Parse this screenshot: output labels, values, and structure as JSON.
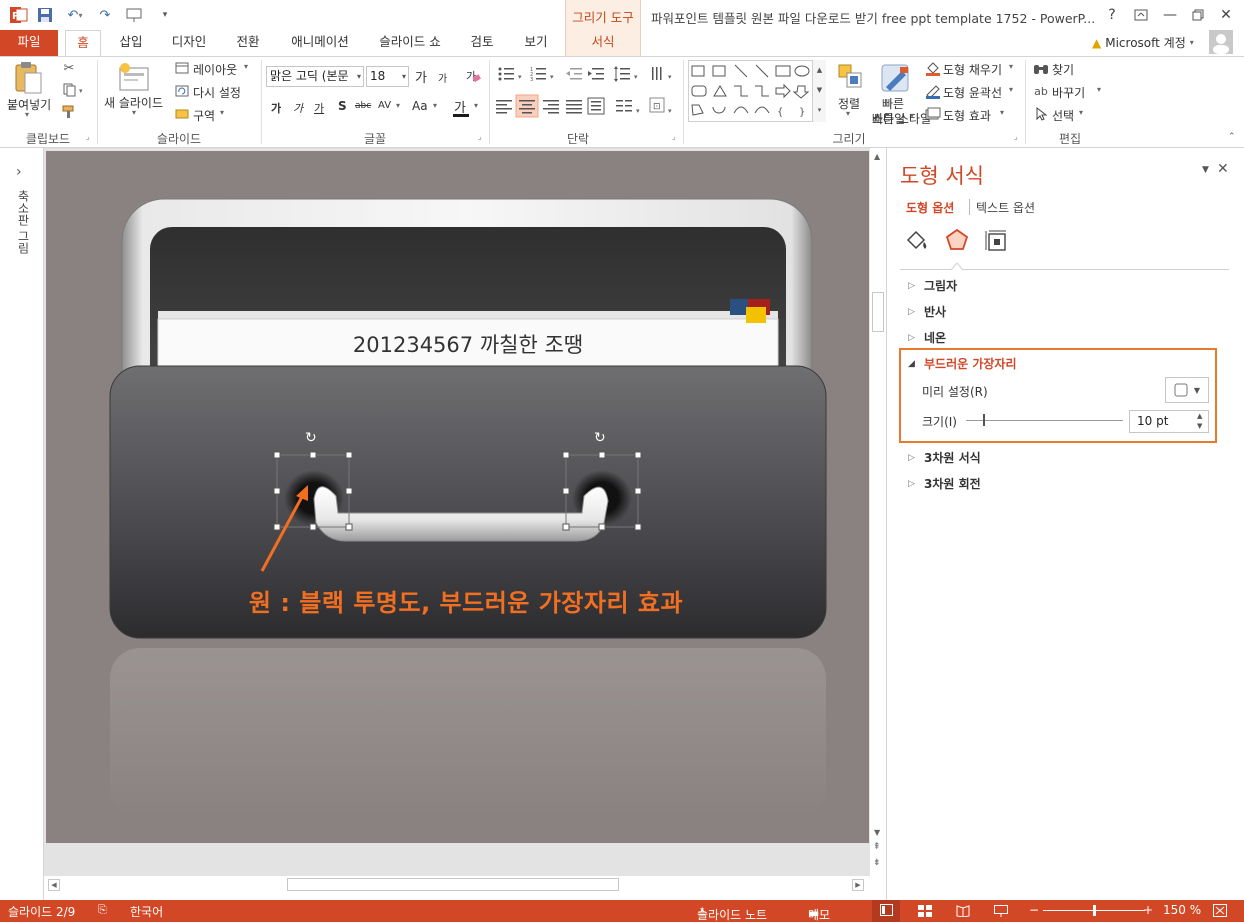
{
  "window": {
    "title": "파워포인트 템플릿 원본 파일 다운로드 받기 free ppt template 1752 - PowerP...",
    "help": "?",
    "context_group": "그리기 도구",
    "account": "Microsoft 계정"
  },
  "tabs": [
    {
      "label": "파일"
    },
    {
      "label": "홈"
    },
    {
      "label": "삽입"
    },
    {
      "label": "디자인"
    },
    {
      "label": "전환"
    },
    {
      "label": "애니메이션"
    },
    {
      "label": "슬라이드 쇼"
    },
    {
      "label": "검토"
    },
    {
      "label": "보기"
    },
    {
      "label": "서식"
    }
  ],
  "ribbon": {
    "clipboard": {
      "name": "클립보드",
      "paste": "붙여넣기"
    },
    "slides": {
      "name": "슬라이드",
      "new_slide": "새 슬라이드",
      "layout": "레이아웃",
      "reset": "다시 설정",
      "section": "구역"
    },
    "font": {
      "name": "글꼴",
      "font_family": "맑은 고딕 (본문",
      "font_size": "18",
      "grow": "가",
      "shrink": "가",
      "bold": "가",
      "italic": "가",
      "underline": "가",
      "shadow": "S",
      "strike": "abc",
      "spacing": "AV",
      "case": "Aa",
      "color": "가"
    },
    "paragraph": {
      "name": "단락"
    },
    "drawing": {
      "name": "그리기",
      "arrange": "정렬",
      "quick_styles": "빠른 스타일",
      "fill": "도형 채우기",
      "outline": "도형 윤곽선",
      "effects": "도형 효과"
    },
    "editing": {
      "name": "편집",
      "find": "찾기",
      "replace": "바꾸기",
      "select": "선택"
    }
  },
  "left_rail": {
    "label": "축소판 그림",
    "expand": "›"
  },
  "slide": {
    "tab_text": "201234567 까칠한 조땡",
    "caption": "원 : 블랙 투명도, 부드러운 가장자리 효과",
    "caption_color": "#f26f21"
  },
  "pane": {
    "title": "도형 서식",
    "tabs": [
      {
        "label": "도형 옵션"
      },
      {
        "label": "텍스트 옵션"
      }
    ],
    "sections": [
      {
        "label": "그림자"
      },
      {
        "label": "반사"
      },
      {
        "label": "네온"
      },
      {
        "label": "부드러운 가장자리"
      },
      {
        "label": "3차원 서식"
      },
      {
        "label": "3차원 회전"
      }
    ],
    "soft_edge": {
      "preset_label": "미리 설정(R)",
      "size_label": "크기(I)",
      "size_value": "10 pt"
    },
    "highlight_color": "#e8792e"
  },
  "status": {
    "slide": "슬라이드 2/9",
    "language": "한국어",
    "notes": "슬라이드 노트",
    "comments": "메모",
    "zoom": "150 %"
  },
  "colors": {
    "accent": "#d24726",
    "accent_light": "#fdeee4"
  }
}
